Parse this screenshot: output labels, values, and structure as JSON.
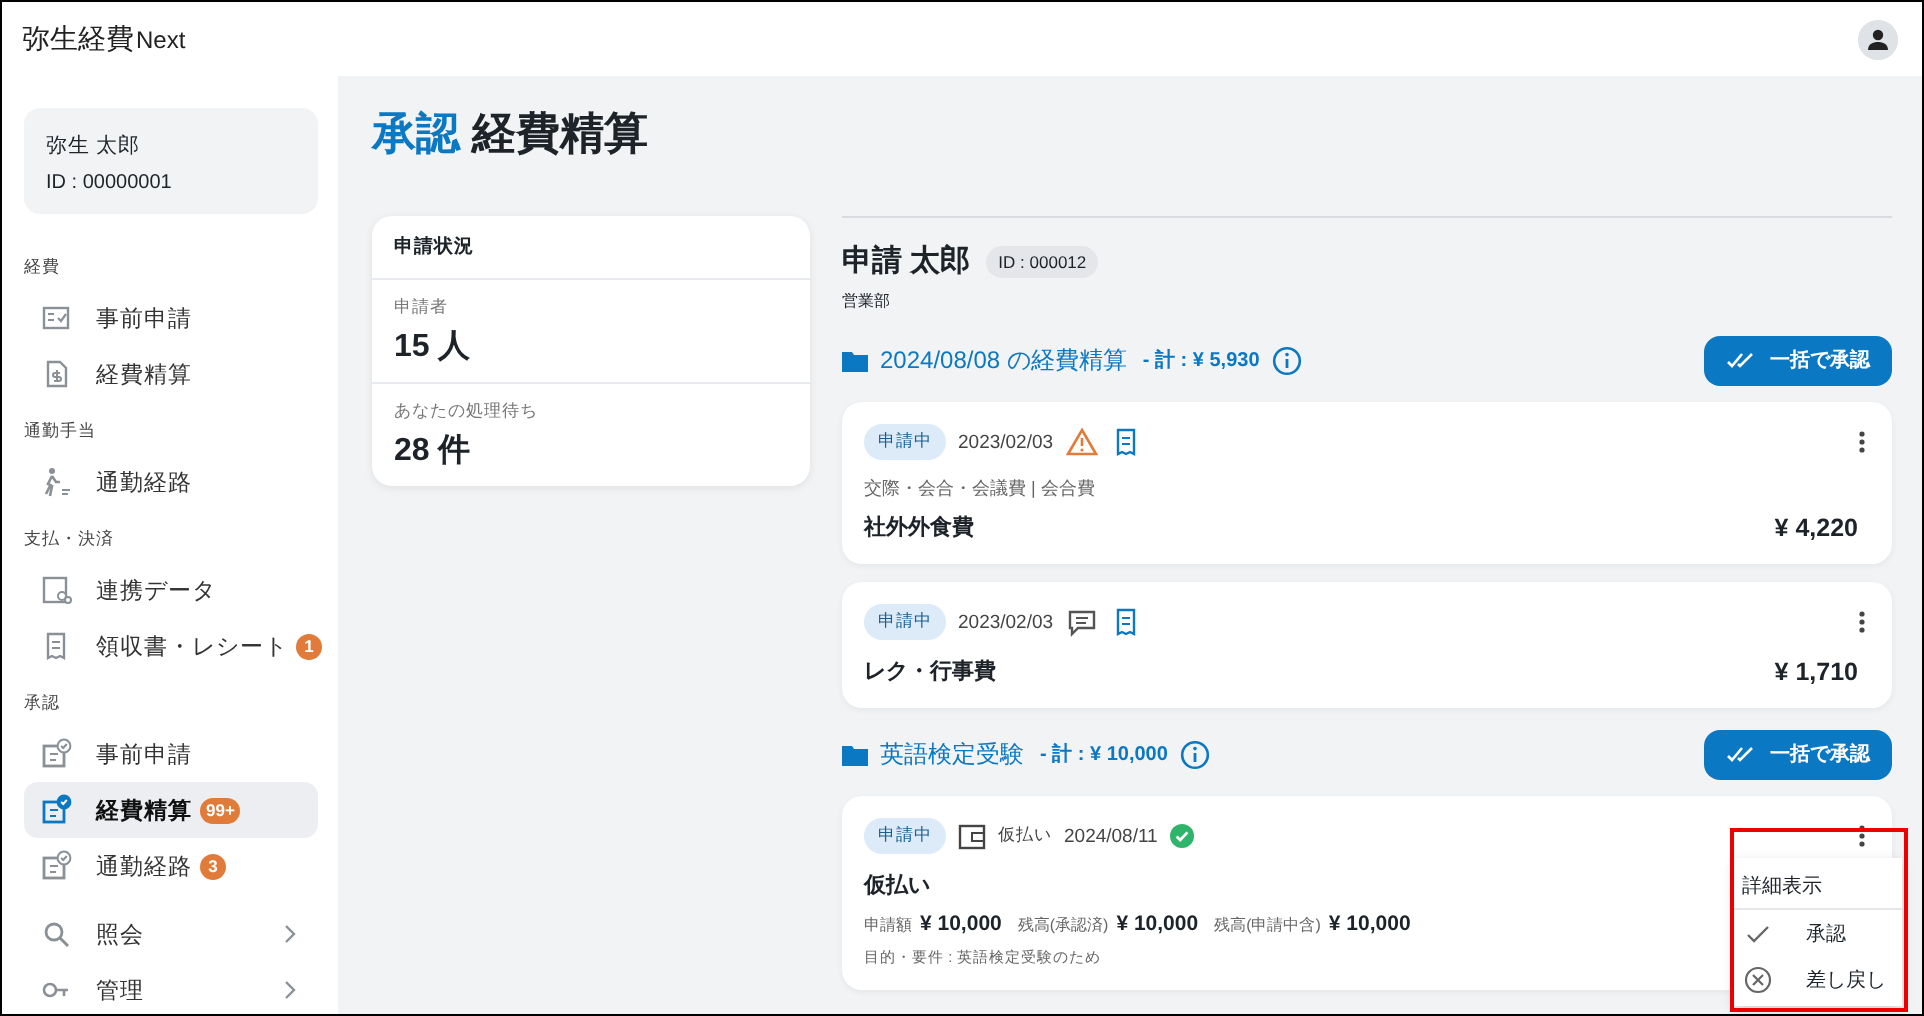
{
  "app": {
    "logo": "弥生経費",
    "logo_suffix": "Next"
  },
  "user": {
    "name": "弥生 太郎",
    "id": "ID : 00000001"
  },
  "sidebar": {
    "sections": [
      {
        "label": "経費",
        "items": [
          {
            "label": "事前申請",
            "selected": false
          },
          {
            "label": "経費精算",
            "selected": false
          }
        ]
      },
      {
        "label": "通勤手当",
        "items": [
          {
            "label": "通勤経路",
            "selected": false
          }
        ]
      },
      {
        "label": "支払・決済",
        "items": [
          {
            "label": "連携データ",
            "selected": false
          },
          {
            "label": "領収書・レシート",
            "selected": false,
            "badge": "1"
          }
        ]
      },
      {
        "label": "承認",
        "items": [
          {
            "label": "事前申請",
            "selected": false
          },
          {
            "label": "経費精算",
            "selected": true,
            "badge": "99+"
          },
          {
            "label": "通勤経路",
            "selected": false,
            "badge": "3"
          }
        ]
      }
    ],
    "footer_items": [
      {
        "label": "照会"
      },
      {
        "label": "管理"
      }
    ]
  },
  "page": {
    "prefix": "承認",
    "title": "経費精算"
  },
  "status_card": {
    "title": "申請状況",
    "stats": [
      {
        "label": "申請者",
        "value": "15 人"
      },
      {
        "label": "あなたの処理待ち",
        "value": "28 件"
      }
    ]
  },
  "applicant": {
    "name": "申請 太郎",
    "id": "ID : 000012",
    "department": "営業部"
  },
  "groups": [
    {
      "title": "2024/08/08 の経費精算",
      "total": "- 計 : ¥ 5,930",
      "button": "一括で承認",
      "items": [
        {
          "kind": "expense",
          "status": "申請中",
          "date": "2023/02/03",
          "warning": true,
          "comment": false,
          "receipt": true,
          "category": "交際・会合・会議費 | 会合費",
          "name": "社外外食費",
          "amount": "¥ 4,220"
        },
        {
          "kind": "expense",
          "status": "申請中",
          "date": "2023/02/03",
          "warning": false,
          "comment": true,
          "receipt": true,
          "name": "レク・行事費",
          "amount": "¥ 1,710"
        }
      ]
    },
    {
      "title": "英語検定受験",
      "total": "- 計 : ¥ 10,000",
      "button": "一括で承認",
      "items": [
        {
          "kind": "advance",
          "status": "申請中",
          "type_label": "仮払い",
          "date": "2024/08/11",
          "verified": true,
          "name": "仮払い",
          "amounts": [
            {
              "label": "申請額",
              "value": "¥ 10,000"
            },
            {
              "label": "残高(承認済)",
              "value": "¥ 10,000"
            },
            {
              "label": "残高(申請中含)",
              "value": "¥ 10,000"
            }
          ],
          "purpose": "目的・要件 : 英語検定受験のため"
        }
      ]
    }
  ],
  "menu": {
    "highlighted": true,
    "items": [
      {
        "label": "詳細表示"
      },
      {
        "label": "承認"
      },
      {
        "label": "差し戻し"
      }
    ]
  }
}
